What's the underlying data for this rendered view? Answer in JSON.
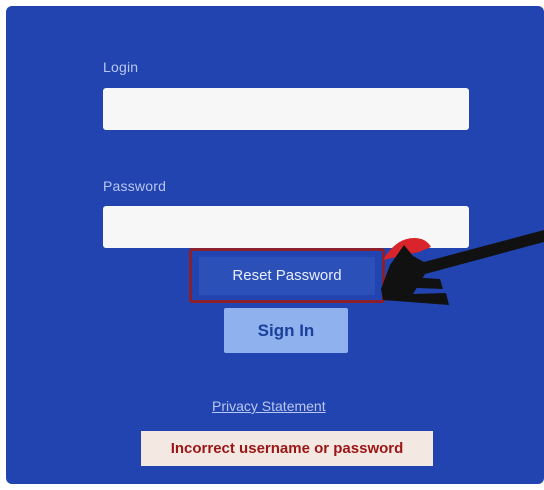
{
  "form": {
    "login_label": "Login",
    "login_value": "",
    "password_label": "Password",
    "password_value": "",
    "reset_password_label": "Reset Password",
    "sign_in_label": "Sign In",
    "privacy_link": "Privacy Statement",
    "error_message": "Incorrect username or password"
  },
  "icons": {
    "annotation_arrow": "arrow-pointing-left-icon"
  },
  "colors": {
    "panel_background": "#2144b0",
    "label_text": "#b9c7ef",
    "field_background": "#f7f7f7",
    "reset_highlight_border": "#8c1f2c",
    "sign_in_background": "#8fb2ee",
    "sign_in_text": "#1c3f9a",
    "error_background": "#f4e9e2",
    "error_text": "#9a1616",
    "annotation_arrow": "#111111",
    "annotation_accent": "#d8242a"
  }
}
